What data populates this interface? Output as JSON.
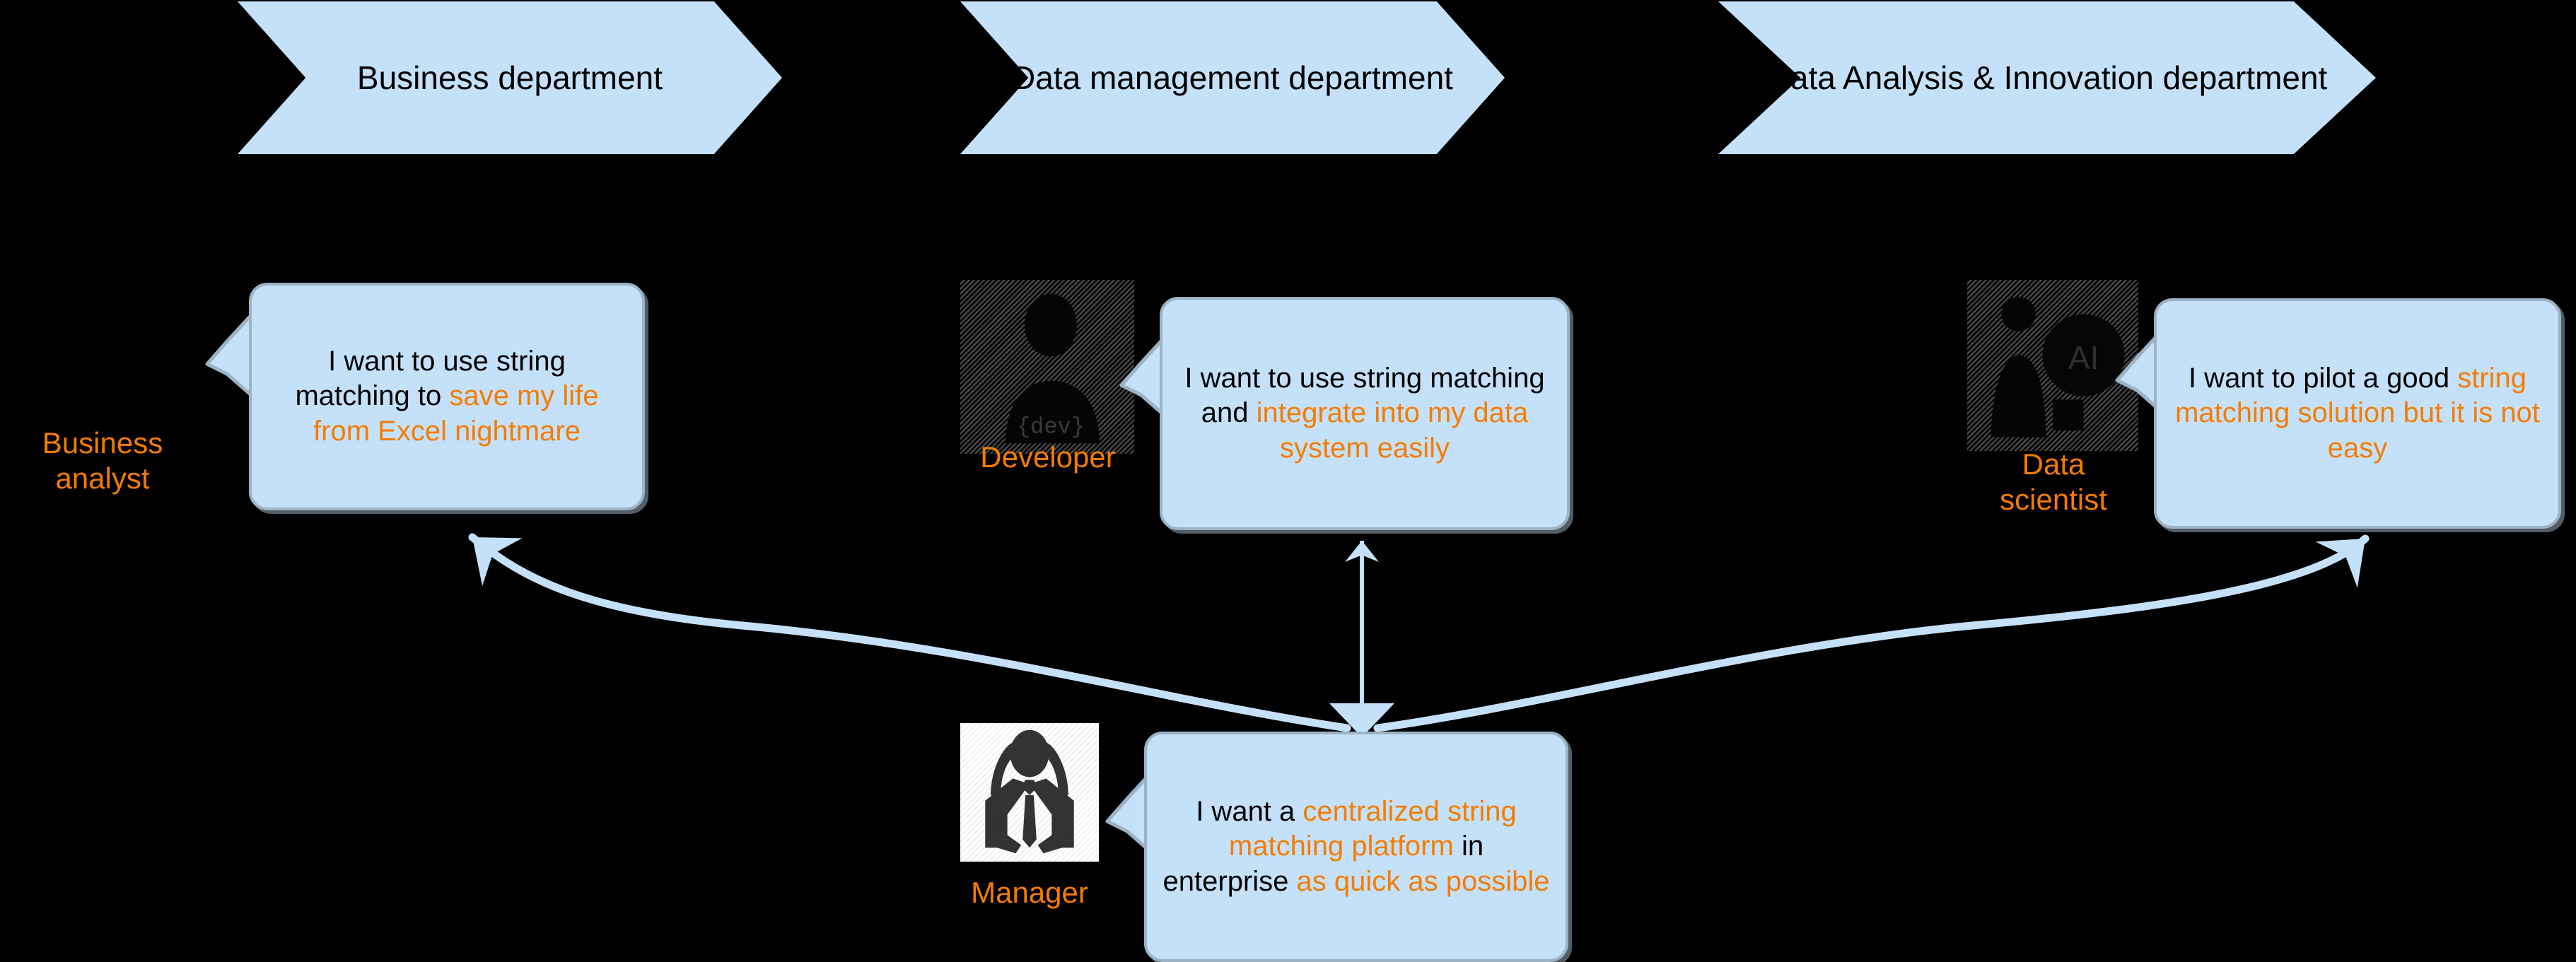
{
  "theme": {
    "background": "#000000",
    "accent_blue": "#C5E1F9",
    "border_blue_gray": "#9BB3C4",
    "highlight_orange": "#F57C00",
    "text_black": "#000000"
  },
  "departments": [
    {
      "id": "business",
      "label": "Business\ndepartment"
    },
    {
      "id": "data-management",
      "label": "Data management\ndepartment"
    },
    {
      "id": "data-analysis",
      "label": "Data Analysis &\nInnovation department"
    }
  ],
  "roles": [
    {
      "id": "business-analyst",
      "label": "Business\nanalyst",
      "icon": "person-silhouette-icon",
      "quote_parts": [
        {
          "text": "I want to use string matching to ",
          "highlight": false
        },
        {
          "text": "save my life from Excel nightmare",
          "highlight": true
        }
      ]
    },
    {
      "id": "developer",
      "label": "Developer",
      "icon": "developer-avatar-icon",
      "quote_parts": [
        {
          "text": "I want to use string matching and ",
          "highlight": false
        },
        {
          "text": "integrate into my data system easily",
          "highlight": true
        }
      ]
    },
    {
      "id": "data-scientist",
      "label": "Data\nscientist",
      "icon": "data-scientist-ai-avatar-icon",
      "quote_parts": [
        {
          "text": "I want to pilot a good ",
          "highlight": false
        },
        {
          "text": "string matching solution but it is not easy",
          "highlight": true
        }
      ]
    },
    {
      "id": "manager",
      "label": "Manager",
      "icon": "manager-suit-avatar-icon",
      "quote_parts": [
        {
          "text": "I want a ",
          "highlight": false
        },
        {
          "text": "centralized string matching platform",
          "highlight": true
        },
        {
          "text": " in enterprise ",
          "highlight": false
        },
        {
          "text": "as quick as possible",
          "highlight": true
        }
      ]
    }
  ],
  "connectors": [
    {
      "id": "manager-to-business-analyst",
      "from": "manager",
      "to": "business-analyst",
      "arrow": "single"
    },
    {
      "id": "manager-to-developer",
      "from": "manager",
      "to": "developer",
      "arrow": "double"
    },
    {
      "id": "manager-to-data-scientist",
      "from": "manager",
      "to": "data-scientist",
      "arrow": "single"
    }
  ]
}
